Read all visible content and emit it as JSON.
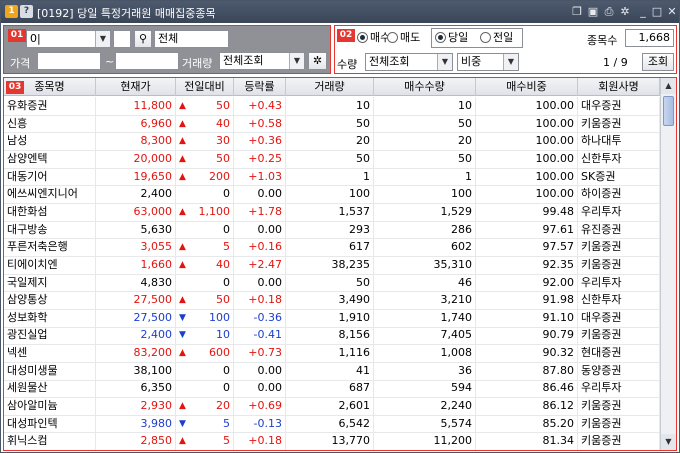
{
  "window": {
    "screen_code": "[0192]",
    "title": "당일 특정거래원 매매집중종목",
    "app_icon": "1",
    "help_icon": "?"
  },
  "panel1": {
    "badge": "01",
    "broker_code": "0|",
    "broker_name": "전체",
    "price_label": "가격",
    "price_from": "",
    "price_sep": "~",
    "price_to": "",
    "volume_label": "거래량",
    "volume_select": "전체조회"
  },
  "panel2": {
    "badge": "02",
    "trade_type": [
      {
        "label": "매수",
        "selected": true
      },
      {
        "label": "매도",
        "selected": false
      }
    ],
    "day_type": [
      {
        "label": "당일",
        "selected": true
      },
      {
        "label": "전일",
        "selected": false
      }
    ],
    "count_label": "종목수",
    "count_value": "1,668",
    "qty_label": "수량",
    "qty_select": "전체조회",
    "ratio_select": "비중",
    "page_indicator": "1 / 9",
    "query_button": "조회"
  },
  "grid": {
    "badge": "03",
    "columns": [
      "종목명",
      "현재가",
      "전일대비",
      "등락률",
      "거래량",
      "매수수량",
      "매수비중",
      "회원사명"
    ],
    "rows": [
      {
        "name": "유화증권",
        "price": "11,800",
        "dir": "up",
        "change": "50",
        "rate": "+0.43",
        "volume": "10",
        "buy_qty": "10",
        "buy_ratio": "100.00",
        "member": "대우증권"
      },
      {
        "name": "신흥",
        "price": "6,960",
        "dir": "up",
        "change": "40",
        "rate": "+0.58",
        "volume": "50",
        "buy_qty": "50",
        "buy_ratio": "100.00",
        "member": "키움증권"
      },
      {
        "name": "남성",
        "price": "8,300",
        "dir": "up",
        "change": "30",
        "rate": "+0.36",
        "volume": "20",
        "buy_qty": "20",
        "buy_ratio": "100.00",
        "member": "하나대투"
      },
      {
        "name": "삼양엔텍",
        "price": "20,000",
        "dir": "up",
        "change": "50",
        "rate": "+0.25",
        "volume": "50",
        "buy_qty": "50",
        "buy_ratio": "100.00",
        "member": "신한투자"
      },
      {
        "name": "대동기어",
        "price": "19,650",
        "dir": "up",
        "change": "200",
        "rate": "+1.03",
        "volume": "1",
        "buy_qty": "1",
        "buy_ratio": "100.00",
        "member": "SK증권"
      },
      {
        "name": "에쓰씨엔지니어",
        "price": "2,400",
        "dir": "flat",
        "change": "0",
        "rate": "0.00",
        "volume": "100",
        "buy_qty": "100",
        "buy_ratio": "100.00",
        "member": "하이증권"
      },
      {
        "name": "대한화섬",
        "price": "63,000",
        "dir": "up",
        "change": "1,100",
        "rate": "+1.78",
        "volume": "1,537",
        "buy_qty": "1,529",
        "buy_ratio": "99.48",
        "member": "우리투자"
      },
      {
        "name": "대구방송",
        "price": "5,630",
        "dir": "flat",
        "change": "0",
        "rate": "0.00",
        "volume": "293",
        "buy_qty": "286",
        "buy_ratio": "97.61",
        "member": "유진증권"
      },
      {
        "name": "푸른저축은행",
        "price": "3,055",
        "dir": "up",
        "change": "5",
        "rate": "+0.16",
        "volume": "617",
        "buy_qty": "602",
        "buy_ratio": "97.57",
        "member": "키움증권"
      },
      {
        "name": "티에이치엔",
        "price": "1,660",
        "dir": "up",
        "change": "40",
        "rate": "+2.47",
        "volume": "38,235",
        "buy_qty": "35,310",
        "buy_ratio": "92.35",
        "member": "키움증권"
      },
      {
        "name": "국일제지",
        "price": "4,830",
        "dir": "flat",
        "change": "0",
        "rate": "0.00",
        "volume": "50",
        "buy_qty": "46",
        "buy_ratio": "92.00",
        "member": "우리투자"
      },
      {
        "name": "삼양통상",
        "price": "27,500",
        "dir": "up",
        "change": "50",
        "rate": "+0.18",
        "volume": "3,490",
        "buy_qty": "3,210",
        "buy_ratio": "91.98",
        "member": "신한투자"
      },
      {
        "name": "성보화학",
        "price": "27,500",
        "dir": "down",
        "change": "100",
        "rate": "-0.36",
        "volume": "1,910",
        "buy_qty": "1,740",
        "buy_ratio": "91.10",
        "member": "대우증권"
      },
      {
        "name": "광진실업",
        "price": "2,400",
        "dir": "down",
        "change": "10",
        "rate": "-0.41",
        "volume": "8,156",
        "buy_qty": "7,405",
        "buy_ratio": "90.79",
        "member": "키움증권"
      },
      {
        "name": "넥센",
        "price": "83,200",
        "dir": "up",
        "change": "600",
        "rate": "+0.73",
        "volume": "1,116",
        "buy_qty": "1,008",
        "buy_ratio": "90.32",
        "member": "현대증권"
      },
      {
        "name": "대성미생물",
        "price": "38,100",
        "dir": "flat",
        "change": "0",
        "rate": "0.00",
        "volume": "41",
        "buy_qty": "36",
        "buy_ratio": "87.80",
        "member": "동양증권"
      },
      {
        "name": "세원물산",
        "price": "6,350",
        "dir": "flat",
        "change": "0",
        "rate": "0.00",
        "volume": "687",
        "buy_qty": "594",
        "buy_ratio": "86.46",
        "member": "우리투자"
      },
      {
        "name": "삼아알미늄",
        "price": "2,930",
        "dir": "up",
        "change": "20",
        "rate": "+0.69",
        "volume": "2,601",
        "buy_qty": "2,240",
        "buy_ratio": "86.12",
        "member": "키움증권"
      },
      {
        "name": "대성파인텍",
        "price": "3,980",
        "dir": "down",
        "change": "5",
        "rate": "-0.13",
        "volume": "6,542",
        "buy_qty": "5,574",
        "buy_ratio": "85.20",
        "member": "키움증권"
      },
      {
        "name": "휘닉스컴",
        "price": "2,850",
        "dir": "up",
        "change": "5",
        "rate": "+0.18",
        "volume": "13,770",
        "buy_qty": "11,200",
        "buy_ratio": "81.34",
        "member": "키움증권"
      }
    ]
  },
  "colors": {
    "up": "#e3140f",
    "down": "#1c3ecb",
    "accent": "#e5372f",
    "titlebar": "#3f4a5c"
  },
  "icons": [
    "app-icon",
    "help-icon",
    "layout-icon",
    "save-icon",
    "print-icon",
    "settings-icon",
    "minimize-icon",
    "maximize-icon",
    "close-icon",
    "search-icon",
    "gear-icon",
    "chevron-down-icon"
  ]
}
